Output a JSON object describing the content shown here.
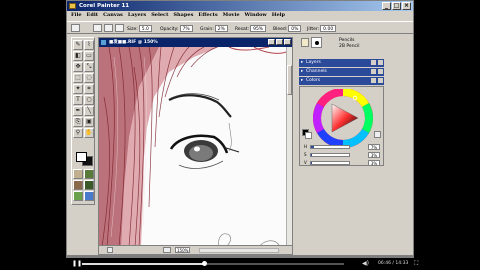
{
  "app": {
    "title": "Corel Painter 11"
  },
  "menu": [
    "File",
    "Edit",
    "Canvas",
    "Layers",
    "Select",
    "Shapes",
    "Effects",
    "Movie",
    "Window",
    "Help"
  ],
  "property_bar": {
    "size_label": "Size:",
    "size_value": "5.0",
    "opacity_label": "Opacity:",
    "opacity_value": "7%",
    "grain_label": "Grain:",
    "grain_value": "2%",
    "resat_label": "Resat:",
    "resat_value": "95%",
    "bleed_label": "Bleed:",
    "bleed_value": "0%",
    "jitter_label": "Jitter:",
    "jitter_value": "0.00"
  },
  "document": {
    "title": "■发■■.RIF @ 150%",
    "zoom": "150%"
  },
  "brush": {
    "category": "Pencils",
    "variant": "2B Pencil"
  },
  "palettes": [
    {
      "label": "Layers"
    },
    {
      "label": "Channels"
    },
    {
      "label": "Colors"
    }
  ],
  "color_sliders": [
    {
      "label": "H",
      "value": "7%",
      "fraction": 0.07
    },
    {
      "label": "S",
      "value": "3%",
      "fraction": 0.03
    },
    {
      "label": "V",
      "value": "3%",
      "fraction": 0.03
    }
  ],
  "colors": {
    "accent": "#2c4a9a",
    "title_bar": "#0a246a",
    "hair": "#b5454f"
  },
  "player": {
    "time": "06:46 / 14:33",
    "progress": 0.466
  }
}
